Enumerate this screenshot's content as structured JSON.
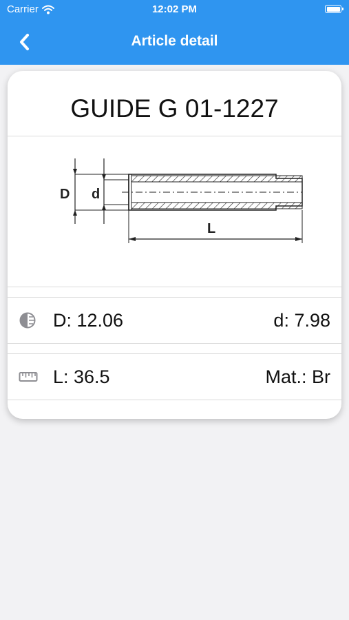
{
  "status_bar": {
    "carrier": "Carrier",
    "time": "12:02 PM"
  },
  "nav": {
    "title": "Article detail",
    "back_icon": "chevron-left-icon"
  },
  "article": {
    "name": "GUIDE G 01-1227",
    "drawing_labels": {
      "outer_diameter": "D",
      "inner_diameter": "d",
      "length": "L"
    },
    "specs": {
      "outer_diameter": "D: 12.06",
      "inner_diameter": "d: 7.98",
      "length": "L: 36.5",
      "material": "Mat.: Br"
    }
  },
  "colors": {
    "accent": "#2f95f0",
    "background": "#f2f2f4",
    "card": "#ffffff",
    "icon": "#8e8e93"
  }
}
